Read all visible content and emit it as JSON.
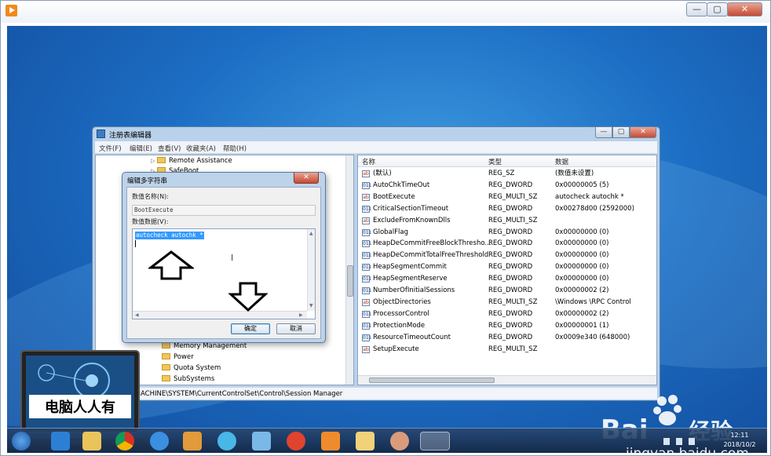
{
  "player": {
    "close_glyph": "✕",
    "min_glyph": "—",
    "max_glyph": "▢"
  },
  "regedit": {
    "title": "注册表编辑器",
    "menu": [
      "文件(F)",
      "编辑(E)",
      "查看(V)",
      "收藏夹(A)",
      "帮助(H)"
    ],
    "tree_items_top": [
      {
        "label": "Remote Assistance",
        "expander": "▷"
      },
      {
        "label": "SafeBoot",
        "expander": "▷"
      }
    ],
    "tree_items_bottom": [
      {
        "label": "Memory Management",
        "expander": ""
      },
      {
        "label": "Power",
        "expander": ""
      },
      {
        "label": "Quota System",
        "expander": ""
      },
      {
        "label": "SubSystems",
        "expander": ""
      }
    ],
    "columns": {
      "name": "名称",
      "type": "类型",
      "data": "数据"
    },
    "values": [
      {
        "name": "(默认)",
        "type": "REG_SZ",
        "data": "(数值未设置)",
        "icon": "string-value-icon"
      },
      {
        "name": "AutoChkTimeOut",
        "type": "REG_DWORD",
        "data": "0x00000005 (5)",
        "icon": "binary-value-icon"
      },
      {
        "name": "BootExecute",
        "type": "REG_MULTI_SZ",
        "data": "autocheck autochk *",
        "icon": "string-value-icon"
      },
      {
        "name": "CriticalSectionTimeout",
        "type": "REG_DWORD",
        "data": "0x00278d00 (2592000)",
        "icon": "binary-value-icon"
      },
      {
        "name": "ExcludeFromKnownDlls",
        "type": "REG_MULTI_SZ",
        "data": "",
        "icon": "string-value-icon"
      },
      {
        "name": "GlobalFlag",
        "type": "REG_DWORD",
        "data": "0x00000000 (0)",
        "icon": "binary-value-icon"
      },
      {
        "name": "HeapDeCommitFreeBlockThresho...",
        "type": "REG_DWORD",
        "data": "0x00000000 (0)",
        "icon": "binary-value-icon"
      },
      {
        "name": "HeapDeCommitTotalFreeThreshold",
        "type": "REG_DWORD",
        "data": "0x00000000 (0)",
        "icon": "binary-value-icon"
      },
      {
        "name": "HeapSegmentCommit",
        "type": "REG_DWORD",
        "data": "0x00000000 (0)",
        "icon": "binary-value-icon"
      },
      {
        "name": "HeapSegmentReserve",
        "type": "REG_DWORD",
        "data": "0x00000000 (0)",
        "icon": "binary-value-icon"
      },
      {
        "name": "NumberOfInitialSessions",
        "type": "REG_DWORD",
        "data": "0x00000002 (2)",
        "icon": "binary-value-icon"
      },
      {
        "name": "ObjectDirectories",
        "type": "REG_MULTI_SZ",
        "data": "\\Windows \\RPC Control",
        "icon": "string-value-icon"
      },
      {
        "name": "ProcessorControl",
        "type": "REG_DWORD",
        "data": "0x00000002 (2)",
        "icon": "binary-value-icon"
      },
      {
        "name": "ProtectionMode",
        "type": "REG_DWORD",
        "data": "0x00000001 (1)",
        "icon": "binary-value-icon"
      },
      {
        "name": "ResourceTimeoutCount",
        "type": "REG_DWORD",
        "data": "0x0009e340 (648000)",
        "icon": "binary-value-icon"
      },
      {
        "name": "SetupExecute",
        "type": "REG_MULTI_SZ",
        "data": "",
        "icon": "string-value-icon"
      }
    ],
    "status_path": "EY_LOCAL_MACHINE\\SYSTEM\\CurrentControlSet\\Control\\Session Manager"
  },
  "dialog": {
    "title": "编辑多字符串",
    "close_glyph": "✕",
    "name_label": "数值名称(N):",
    "name_value": "BootExecute",
    "data_label": "数值数据(V):",
    "data_value": "autocheck autochk *",
    "ok_label": "确定",
    "cancel_label": "取消"
  },
  "overlay": {
    "laptop_caption": "电脑人人有"
  },
  "taskbar": {
    "time": "12:11",
    "date": "2018/10/2",
    "app_icons": [
      "windows-start-icon",
      "ie-browser-icon",
      "file-explorer-icon",
      "chrome-icon",
      "qq-icon",
      "paint-icon",
      "browser-icon",
      "pinwheel-icon",
      "game-icon",
      "video-player-icon",
      "folder-icon",
      "monkey-icon",
      "regedit-icon"
    ]
  },
  "watermark": {
    "brand": "Bai",
    "brand2": "经验",
    "url": "jingyan.baidu.com"
  },
  "colors": {
    "desktop": "#1c6ec4",
    "window_frame": "#b9d1ea",
    "selection": "#3399ff",
    "close": "#c74a33"
  }
}
